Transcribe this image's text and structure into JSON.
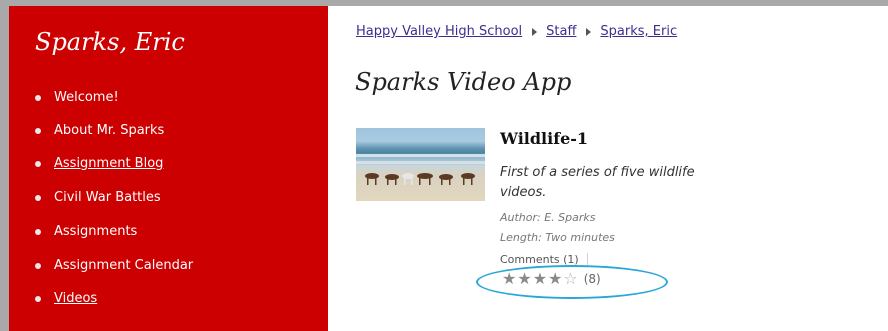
{
  "sidebar": {
    "title": "Sparks, Eric",
    "items": [
      {
        "label": "Welcome!"
      },
      {
        "label": "About Mr. Sparks"
      },
      {
        "label": "Assignment Blog"
      },
      {
        "label": "Civil War Battles"
      },
      {
        "label": "Assignments"
      },
      {
        "label": "Assignment Calendar"
      },
      {
        "label": "Videos"
      }
    ]
  },
  "breadcrumb": {
    "items": [
      "Happy Valley High School",
      "Staff",
      "Sparks, Eric"
    ]
  },
  "page": {
    "title": "Sparks Video App"
  },
  "video": {
    "thumbnail_icon": "beach-horses-thumbnail",
    "title": "Wildlife-1",
    "description": "First of a series of five wildlife videos.",
    "author": "Author: E. Sparks",
    "length": "Length: Two minutes",
    "comments": "Comments (1)",
    "rating": 4.5,
    "rating_max": 5,
    "rating_count": "(8)"
  },
  "colors": {
    "sidebar_bg": "#cc0000",
    "frame": "#a9a9a9",
    "link": "#3a2f8f",
    "highlight": "#29a8d8"
  }
}
